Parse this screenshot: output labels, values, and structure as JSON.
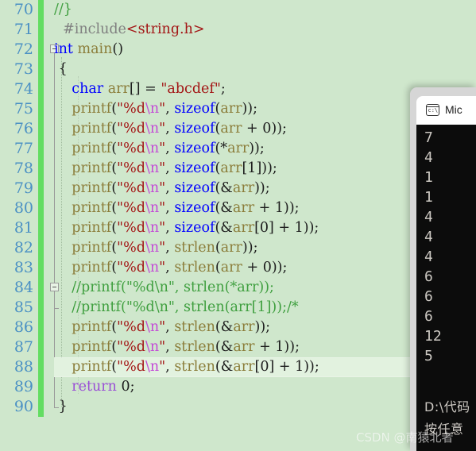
{
  "editor": {
    "first_line_number": 70,
    "current_line_number": 88,
    "colors": {
      "background": "#cfe7cc",
      "line_number": "#4a90c4",
      "change_bar": "#63dd62",
      "current_line_highlight": "#e2f2df",
      "keyword": "#0000ff",
      "string": "#a31515",
      "escape": "#c34ad6",
      "comment": "#3f9f3f",
      "preprocessor": "#808080",
      "identifier": "#8b7d3a",
      "return_keyword": "#9a4fd6"
    },
    "lines": [
      {
        "n": "70",
        "tokens": [
          {
            "t": "//}",
            "c": "t-cmt"
          }
        ]
      },
      {
        "n": "71",
        "tokens": [
          {
            "t": "  ",
            "c": "t-punct"
          },
          {
            "t": "#include",
            "c": "t-pp"
          },
          {
            "t": "<string.h>",
            "c": "t-inc"
          }
        ]
      },
      {
        "n": "72",
        "tokens": [
          {
            "t": "int",
            "c": "t-type"
          },
          {
            "t": " ",
            "c": "t-punct"
          },
          {
            "t": "main",
            "c": "t-fn"
          },
          {
            "t": "()",
            "c": "t-punct"
          }
        ]
      },
      {
        "n": "73",
        "tokens": [
          {
            "t": " {",
            "c": "t-punct"
          }
        ]
      },
      {
        "n": "74",
        "tokens": [
          {
            "t": "    ",
            "c": "t-punct"
          },
          {
            "t": "char",
            "c": "t-type"
          },
          {
            "t": " ",
            "c": "t-punct"
          },
          {
            "t": "arr",
            "c": "t-id"
          },
          {
            "t": "[] = ",
            "c": "t-punct"
          },
          {
            "t": "\"abcdef\"",
            "c": "t-str"
          },
          {
            "t": ";",
            "c": "t-punct"
          }
        ]
      },
      {
        "n": "75",
        "tokens": [
          {
            "t": "    ",
            "c": "t-punct"
          },
          {
            "t": "printf",
            "c": "t-fn"
          },
          {
            "t": "(",
            "c": "t-punct"
          },
          {
            "t": "\"%d",
            "c": "t-str"
          },
          {
            "t": "\\n",
            "c": "t-esc"
          },
          {
            "t": "\"",
            "c": "t-str"
          },
          {
            "t": ", ",
            "c": "t-punct"
          },
          {
            "t": "sizeof",
            "c": "t-kw"
          },
          {
            "t": "(",
            "c": "t-punct"
          },
          {
            "t": "arr",
            "c": "t-id"
          },
          {
            "t": "));",
            "c": "t-punct"
          }
        ]
      },
      {
        "n": "76",
        "tokens": [
          {
            "t": "    ",
            "c": "t-punct"
          },
          {
            "t": "printf",
            "c": "t-fn"
          },
          {
            "t": "(",
            "c": "t-punct"
          },
          {
            "t": "\"%d",
            "c": "t-str"
          },
          {
            "t": "\\n",
            "c": "t-esc"
          },
          {
            "t": "\"",
            "c": "t-str"
          },
          {
            "t": ", ",
            "c": "t-punct"
          },
          {
            "t": "sizeof",
            "c": "t-kw"
          },
          {
            "t": "(",
            "c": "t-punct"
          },
          {
            "t": "arr",
            "c": "t-id"
          },
          {
            "t": " + 0));",
            "c": "t-punct"
          }
        ]
      },
      {
        "n": "77",
        "tokens": [
          {
            "t": "    ",
            "c": "t-punct"
          },
          {
            "t": "printf",
            "c": "t-fn"
          },
          {
            "t": "(",
            "c": "t-punct"
          },
          {
            "t": "\"%d",
            "c": "t-str"
          },
          {
            "t": "\\n",
            "c": "t-esc"
          },
          {
            "t": "\"",
            "c": "t-str"
          },
          {
            "t": ", ",
            "c": "t-punct"
          },
          {
            "t": "sizeof",
            "c": "t-kw"
          },
          {
            "t": "(*",
            "c": "t-punct"
          },
          {
            "t": "arr",
            "c": "t-id"
          },
          {
            "t": "));",
            "c": "t-punct"
          }
        ]
      },
      {
        "n": "78",
        "tokens": [
          {
            "t": "    ",
            "c": "t-punct"
          },
          {
            "t": "printf",
            "c": "t-fn"
          },
          {
            "t": "(",
            "c": "t-punct"
          },
          {
            "t": "\"%d",
            "c": "t-str"
          },
          {
            "t": "\\n",
            "c": "t-esc"
          },
          {
            "t": "\"",
            "c": "t-str"
          },
          {
            "t": ", ",
            "c": "t-punct"
          },
          {
            "t": "sizeof",
            "c": "t-kw"
          },
          {
            "t": "(",
            "c": "t-punct"
          },
          {
            "t": "arr",
            "c": "t-id"
          },
          {
            "t": "[1]));",
            "c": "t-punct"
          }
        ]
      },
      {
        "n": "79",
        "tokens": [
          {
            "t": "    ",
            "c": "t-punct"
          },
          {
            "t": "printf",
            "c": "t-fn"
          },
          {
            "t": "(",
            "c": "t-punct"
          },
          {
            "t": "\"%d",
            "c": "t-str"
          },
          {
            "t": "\\n",
            "c": "t-esc"
          },
          {
            "t": "\"",
            "c": "t-str"
          },
          {
            "t": ", ",
            "c": "t-punct"
          },
          {
            "t": "sizeof",
            "c": "t-kw"
          },
          {
            "t": "(&",
            "c": "t-punct"
          },
          {
            "t": "arr",
            "c": "t-id"
          },
          {
            "t": "));",
            "c": "t-punct"
          }
        ]
      },
      {
        "n": "80",
        "tokens": [
          {
            "t": "    ",
            "c": "t-punct"
          },
          {
            "t": "printf",
            "c": "t-fn"
          },
          {
            "t": "(",
            "c": "t-punct"
          },
          {
            "t": "\"%d",
            "c": "t-str"
          },
          {
            "t": "\\n",
            "c": "t-esc"
          },
          {
            "t": "\"",
            "c": "t-str"
          },
          {
            "t": ", ",
            "c": "t-punct"
          },
          {
            "t": "sizeof",
            "c": "t-kw"
          },
          {
            "t": "(&",
            "c": "t-punct"
          },
          {
            "t": "arr",
            "c": "t-id"
          },
          {
            "t": " + 1));",
            "c": "t-punct"
          }
        ]
      },
      {
        "n": "81",
        "tokens": [
          {
            "t": "    ",
            "c": "t-punct"
          },
          {
            "t": "printf",
            "c": "t-fn"
          },
          {
            "t": "(",
            "c": "t-punct"
          },
          {
            "t": "\"%d",
            "c": "t-str"
          },
          {
            "t": "\\n",
            "c": "t-esc"
          },
          {
            "t": "\"",
            "c": "t-str"
          },
          {
            "t": ", ",
            "c": "t-punct"
          },
          {
            "t": "sizeof",
            "c": "t-kw"
          },
          {
            "t": "(&",
            "c": "t-punct"
          },
          {
            "t": "arr",
            "c": "t-id"
          },
          {
            "t": "[0] + 1));",
            "c": "t-punct"
          }
        ]
      },
      {
        "n": "82",
        "tokens": [
          {
            "t": "    ",
            "c": "t-punct"
          },
          {
            "t": "printf",
            "c": "t-fn"
          },
          {
            "t": "(",
            "c": "t-punct"
          },
          {
            "t": "\"%d",
            "c": "t-str"
          },
          {
            "t": "\\n",
            "c": "t-esc"
          },
          {
            "t": "\"",
            "c": "t-str"
          },
          {
            "t": ", ",
            "c": "t-punct"
          },
          {
            "t": "strlen",
            "c": "t-fn"
          },
          {
            "t": "(",
            "c": "t-punct"
          },
          {
            "t": "arr",
            "c": "t-id"
          },
          {
            "t": "));",
            "c": "t-punct"
          }
        ]
      },
      {
        "n": "83",
        "tokens": [
          {
            "t": "    ",
            "c": "t-punct"
          },
          {
            "t": "printf",
            "c": "t-fn"
          },
          {
            "t": "(",
            "c": "t-punct"
          },
          {
            "t": "\"%d",
            "c": "t-str"
          },
          {
            "t": "\\n",
            "c": "t-esc"
          },
          {
            "t": "\"",
            "c": "t-str"
          },
          {
            "t": ", ",
            "c": "t-punct"
          },
          {
            "t": "strlen",
            "c": "t-fn"
          },
          {
            "t": "(",
            "c": "t-punct"
          },
          {
            "t": "arr",
            "c": "t-id"
          },
          {
            "t": " + 0));",
            "c": "t-punct"
          }
        ]
      },
      {
        "n": "84",
        "tokens": [
          {
            "t": "    //printf(\"%d\\n\", strlen(*arr));",
            "c": "t-cmt"
          }
        ]
      },
      {
        "n": "85",
        "tokens": [
          {
            "t": "    //printf(\"%d\\n\", strlen(arr[1]));/*",
            "c": "t-cmt"
          }
        ]
      },
      {
        "n": "86",
        "tokens": [
          {
            "t": "    ",
            "c": "t-punct"
          },
          {
            "t": "printf",
            "c": "t-fn"
          },
          {
            "t": "(",
            "c": "t-punct"
          },
          {
            "t": "\"%d",
            "c": "t-str"
          },
          {
            "t": "\\n",
            "c": "t-esc"
          },
          {
            "t": "\"",
            "c": "t-str"
          },
          {
            "t": ", ",
            "c": "t-punct"
          },
          {
            "t": "strlen",
            "c": "t-fn"
          },
          {
            "t": "(&",
            "c": "t-punct"
          },
          {
            "t": "arr",
            "c": "t-id"
          },
          {
            "t": "));",
            "c": "t-punct"
          }
        ]
      },
      {
        "n": "87",
        "tokens": [
          {
            "t": "    ",
            "c": "t-punct"
          },
          {
            "t": "printf",
            "c": "t-fn"
          },
          {
            "t": "(",
            "c": "t-punct"
          },
          {
            "t": "\"%d",
            "c": "t-str"
          },
          {
            "t": "\\n",
            "c": "t-esc"
          },
          {
            "t": "\"",
            "c": "t-str"
          },
          {
            "t": ", ",
            "c": "t-punct"
          },
          {
            "t": "strlen",
            "c": "t-fn"
          },
          {
            "t": "(&",
            "c": "t-punct"
          },
          {
            "t": "arr",
            "c": "t-id"
          },
          {
            "t": " + 1));",
            "c": "t-punct"
          }
        ]
      },
      {
        "n": "88",
        "current": true,
        "tokens": [
          {
            "t": "    ",
            "c": "t-punct"
          },
          {
            "t": "printf",
            "c": "t-fn"
          },
          {
            "t": "(",
            "c": "t-punct"
          },
          {
            "t": "\"%d",
            "c": "t-str"
          },
          {
            "t": "\\n",
            "c": "t-esc"
          },
          {
            "t": "\"",
            "c": "t-str"
          },
          {
            "t": ", ",
            "c": "t-punct"
          },
          {
            "t": "strlen",
            "c": "t-fn"
          },
          {
            "t": "(&",
            "c": "t-punct"
          },
          {
            "t": "arr",
            "c": "t-id"
          },
          {
            "t": "[0] + 1));",
            "c": "t-punct"
          }
        ]
      },
      {
        "n": "89",
        "tokens": [
          {
            "t": "    ",
            "c": "t-punct"
          },
          {
            "t": "return",
            "c": "t-ret"
          },
          {
            "t": " 0;",
            "c": "t-punct"
          }
        ]
      },
      {
        "n": "90",
        "tokens": [
          {
            "t": " }",
            "c": "t-punct"
          }
        ]
      }
    ]
  },
  "console": {
    "title": "Mic",
    "icon": "cmd-console-icon",
    "icon_glyph": "c:\\",
    "output_lines": [
      "7",
      "4",
      "1",
      "1",
      "4",
      "4",
      "4",
      "6",
      "6",
      "6",
      "12",
      "5"
    ],
    "path_line": "D:\\代码",
    "prompt_line": "按任意"
  },
  "watermark": {
    "text": "CSDN @南猿北者"
  }
}
